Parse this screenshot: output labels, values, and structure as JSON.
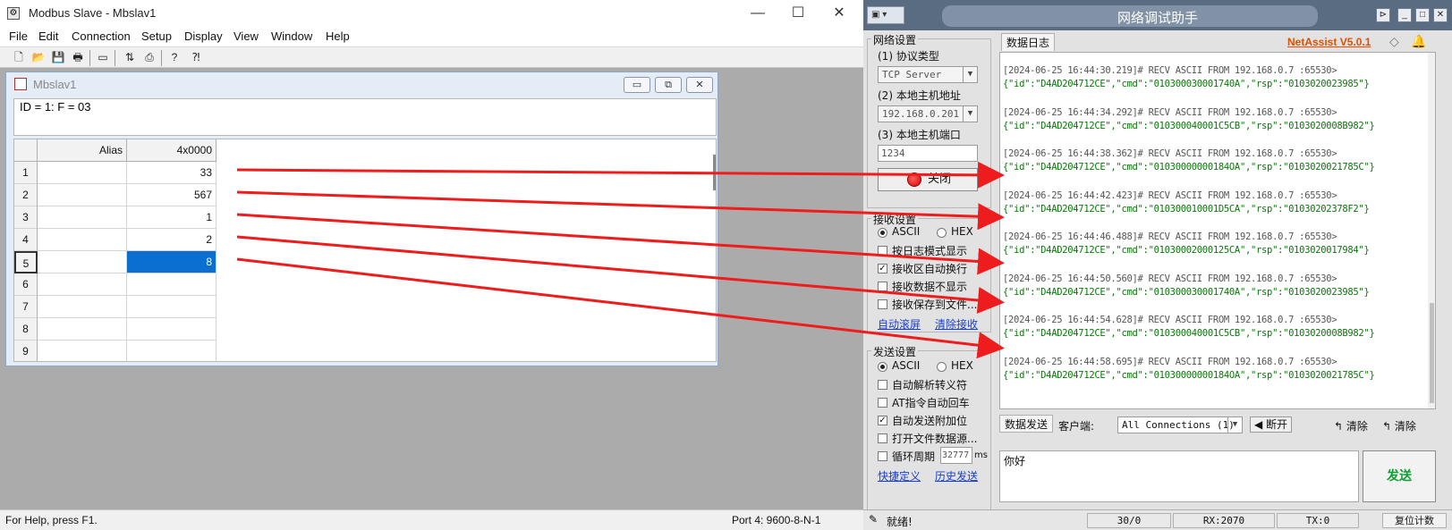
{
  "modbus": {
    "title": "Modbus Slave - Mbslav1",
    "menu": [
      "File",
      "Edit",
      "Connection",
      "Setup",
      "Display",
      "View",
      "Window",
      "Help"
    ],
    "child_title": "Mbslav1",
    "info_text": "ID = 1: F = 03",
    "grid": {
      "headers": [
        "Alias",
        "4x0000"
      ],
      "rows": [
        {
          "num": "1",
          "alias": "",
          "value": "33"
        },
        {
          "num": "2",
          "alias": "",
          "value": "567"
        },
        {
          "num": "3",
          "alias": "",
          "value": "1"
        },
        {
          "num": "4",
          "alias": "",
          "value": "2"
        },
        {
          "num": "5",
          "alias": "",
          "value": "8"
        },
        {
          "num": "6",
          "alias": "",
          "value": ""
        },
        {
          "num": "7",
          "alias": "",
          "value": ""
        },
        {
          "num": "8",
          "alias": "",
          "value": ""
        },
        {
          "num": "9",
          "alias": "",
          "value": ""
        }
      ],
      "selected_row": 5
    },
    "status_left": "For Help, press F1.",
    "status_right": "Port 4: 9600-8-N-1"
  },
  "netassist": {
    "title": "网络调试助手",
    "version": "NetAssist V5.0.1",
    "net_settings": {
      "title": "网络设置",
      "protocol_label": "(1) 协议类型",
      "protocol_value": "TCP Server",
      "host_label": "(2) 本地主机地址",
      "host_value": "192.168.0.201",
      "port_label": "(3) 本地主机端口",
      "port_value": "1234",
      "close_button": "关闭"
    },
    "recv_settings": {
      "title": "接收设置",
      "ascii": "ASCII",
      "hex": "HEX",
      "log_mode": "按日志模式显示",
      "auto_wrap": "接收区自动换行",
      "hide_data": "接收数据不显示",
      "save_file": "接收保存到文件...",
      "auto_scroll": "自动滚屏",
      "clear_recv": "清除接收"
    },
    "send_settings": {
      "title": "发送设置",
      "ascii": "ASCII",
      "hex": "HEX",
      "auto_escape": "自动解析转义符",
      "at_cr": "AT指令自动回车",
      "auto_checksum": "自动发送附加位",
      "file_source": "打开文件数据源...",
      "cycle": "循环周期",
      "cycle_value": "32777",
      "cycle_unit": "ms",
      "shortcut": "快捷定义",
      "history": "历史发送"
    },
    "log_tab": "数据日志",
    "log": [
      {
        "hdr": "[2024-06-25 16:44:30.219]# RECV ASCII FROM 192.168.0.7 :65530>",
        "body": "{\"id\":\"D4AD204712CE\",\"cmd\":\"010300030001740A\",\"rsp\":\"0103020023985\"}"
      },
      {
        "hdr": "[2024-06-25 16:44:34.292]# RECV ASCII FROM 192.168.0.7 :65530>",
        "body": "{\"id\":\"D4AD204712CE\",\"cmd\":\"010300040001C5CB\",\"rsp\":\"0103020008B982\"}"
      },
      {
        "hdr": "[2024-06-25 16:44:38.362]# RECV ASCII FROM 192.168.0.7 :65530>",
        "body": "{\"id\":\"D4AD204712CE\",\"cmd\":\"01030000000184OA\",\"rsp\":\"0103020021785C\"}"
      },
      {
        "hdr": "[2024-06-25 16:44:42.423]# RECV ASCII FROM 192.168.0.7 :65530>",
        "body": "{\"id\":\"D4AD204712CE\",\"cmd\":\"010300010001D5CA\",\"rsp\":\"01030202378F2\"}"
      },
      {
        "hdr": "[2024-06-25 16:44:46.488]# RECV ASCII FROM 192.168.0.7 :65530>",
        "body": "{\"id\":\"D4AD204712CE\",\"cmd\":\"01030002000125CA\",\"rsp\":\"0103020017984\"}"
      },
      {
        "hdr": "[2024-06-25 16:44:50.560]# RECV ASCII FROM 192.168.0.7 :65530>",
        "body": "{\"id\":\"D4AD204712CE\",\"cmd\":\"010300030001740A\",\"rsp\":\"0103020023985\"}"
      },
      {
        "hdr": "[2024-06-25 16:44:54.628]# RECV ASCII FROM 192.168.0.7 :65530>",
        "body": "{\"id\":\"D4AD204712CE\",\"cmd\":\"010300040001C5CB\",\"rsp\":\"0103020008B982\"}"
      },
      {
        "hdr": "[2024-06-25 16:44:58.695]# RECV ASCII FROM 192.168.0.7 :65530>",
        "body": "{\"id\":\"D4AD204712CE\",\"cmd\":\"01030000000184OA\",\"rsp\":\"0103020021785C\"}"
      }
    ],
    "send_bar": {
      "tab": "数据发送",
      "client_label": "客户端:",
      "client_value": "All Connections (1)",
      "disconnect": "断开",
      "clear1": "清除",
      "clear2": "清除"
    },
    "send_text": "你好",
    "send_button": "发送",
    "status": {
      "ready": "就绪!",
      "count": "30/0",
      "rx": "RX:2070",
      "tx": "TX:0",
      "reset": "复位计数"
    }
  }
}
